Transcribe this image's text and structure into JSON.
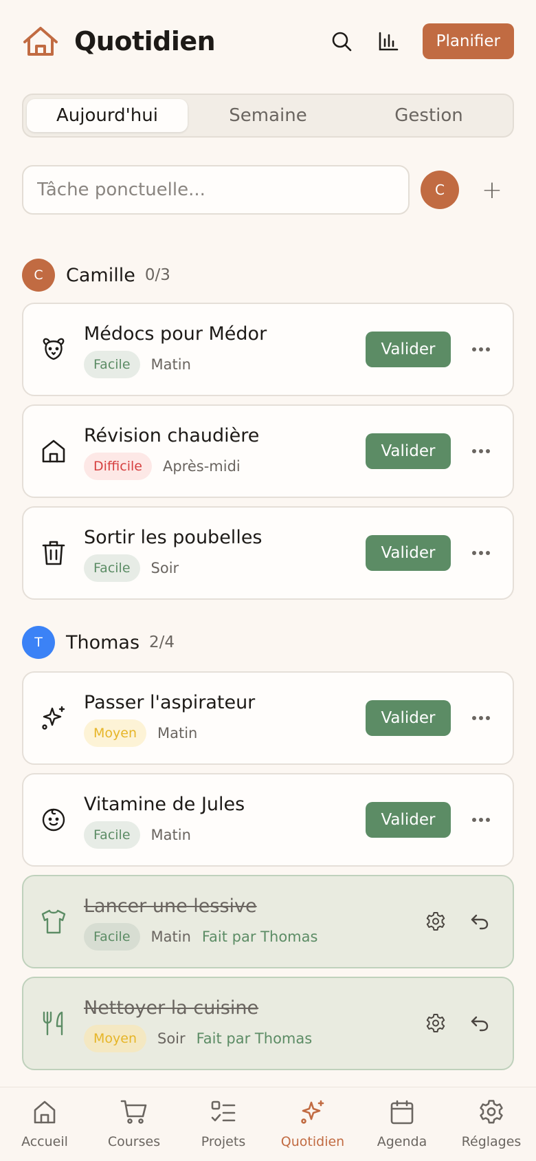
{
  "header": {
    "title": "Quotidien",
    "plan_label": "Planifier"
  },
  "tabs": [
    "Aujourd'hui",
    "Semaine",
    "Gestion"
  ],
  "new_task": {
    "placeholder": "Tâche ponctuelle...",
    "assignee_initial": "C",
    "add_symbol": "+"
  },
  "groups": [
    {
      "initial": "C",
      "name": "Camille",
      "count": "0/3",
      "color": "#c16b42",
      "tasks": [
        {
          "icon": "dog-icon",
          "name": "Médocs pour Médor",
          "difficulty": "Facile",
          "slot": "Matin",
          "action": "Valider"
        },
        {
          "icon": "house-icon",
          "name": "Révision chaudière",
          "difficulty": "Difficile",
          "slot": "Après-midi",
          "action": "Valider"
        },
        {
          "icon": "trash-icon",
          "name": "Sortir les poubelles",
          "difficulty": "Facile",
          "slot": "Soir",
          "action": "Valider"
        }
      ]
    },
    {
      "initial": "T",
      "name": "Thomas",
      "count": "2/4",
      "color": "#3b82f6",
      "tasks": [
        {
          "icon": "sparkles-icon",
          "name": "Passer l'aspirateur",
          "difficulty": "Moyen",
          "slot": "Matin",
          "action": "Valider"
        },
        {
          "icon": "baby-icon",
          "name": "Vitamine de Jules",
          "difficulty": "Facile",
          "slot": "Matin",
          "action": "Valider"
        },
        {
          "icon": "shirt-icon",
          "name": "Lancer une lessive",
          "difficulty": "Facile",
          "slot": "Matin",
          "done_by": "Fait par Thomas"
        },
        {
          "icon": "utensils-icon",
          "name": "Nettoyer la cuisine",
          "difficulty": "Moyen",
          "slot": "Soir",
          "done_by": "Fait par Thomas"
        }
      ]
    }
  ],
  "nav": [
    {
      "label": "Accueil",
      "icon": "home-icon"
    },
    {
      "label": "Courses",
      "icon": "cart-icon"
    },
    {
      "label": "Projets",
      "icon": "list-check-icon"
    },
    {
      "label": "Quotidien",
      "icon": "sparkles-icon",
      "active": true
    },
    {
      "label": "Agenda",
      "icon": "calendar-icon"
    },
    {
      "label": "Réglages",
      "icon": "settings-icon"
    }
  ],
  "colors": {
    "accent": "#c16b42",
    "success": "#5c8c65",
    "danger": "#d64040",
    "warning": "#e6b528"
  }
}
